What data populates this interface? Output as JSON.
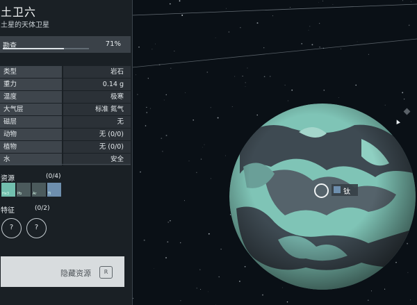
{
  "planet": {
    "name": "土卫六",
    "subtitle": "土星的天体卫星"
  },
  "survey": {
    "label": "勘查",
    "percent_text": "71%",
    "progress": 0.71
  },
  "attributes": [
    {
      "key": "类型",
      "value": "岩石"
    },
    {
      "key": "重力",
      "value": "0.14 g"
    },
    {
      "key": "温度",
      "value": "极寒"
    },
    {
      "key": "大气层",
      "value": "标准 氮气"
    },
    {
      "key": "磁层",
      "value": "无"
    },
    {
      "key": "动物",
      "value": "无 (0/0)"
    },
    {
      "key": "植物",
      "value": "无 (0/0)"
    },
    {
      "key": "水",
      "value": "安全"
    }
  ],
  "resources": {
    "label": "资源",
    "count": "(0/4)",
    "tiles": [
      {
        "symbol": "He3",
        "color": "#72bfae"
      },
      {
        "symbol": "Pb",
        "color": "#4b5a5c"
      },
      {
        "symbol": "Ar",
        "color": "#4b5a5c"
      },
      {
        "symbol": "Ti",
        "color": "#6e8fae"
      }
    ]
  },
  "traits": {
    "label": "特征",
    "count": "(0/2)",
    "items": [
      "?",
      "?"
    ]
  },
  "hide_button": {
    "label": "隐藏资源",
    "key": "R"
  },
  "planet_marker": {
    "label": "钛",
    "color": "#6e8fae"
  },
  "colors": {
    "planet_teal": "#7fc4b6",
    "planet_dark": "#3e4a52",
    "panel_bg": "#1c2126"
  }
}
